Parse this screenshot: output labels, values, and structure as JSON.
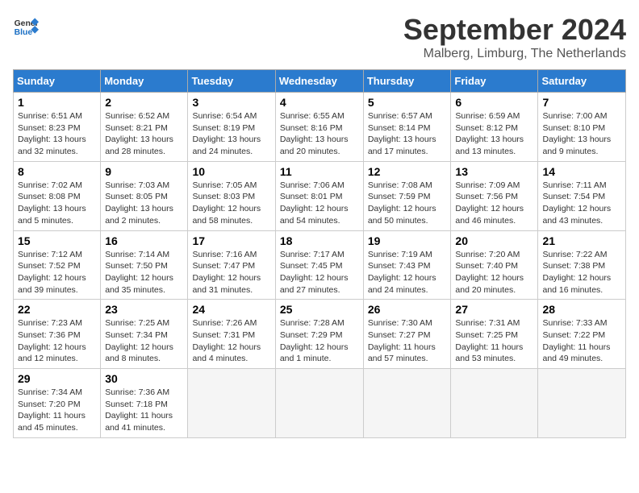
{
  "header": {
    "logo_line1": "General",
    "logo_line2": "Blue",
    "month_title": "September 2024",
    "subtitle": "Malberg, Limburg, The Netherlands"
  },
  "weekdays": [
    "Sunday",
    "Monday",
    "Tuesday",
    "Wednesday",
    "Thursday",
    "Friday",
    "Saturday"
  ],
  "weeks": [
    [
      {
        "day": "1",
        "info": "Sunrise: 6:51 AM\nSunset: 8:23 PM\nDaylight: 13 hours\nand 32 minutes."
      },
      {
        "day": "2",
        "info": "Sunrise: 6:52 AM\nSunset: 8:21 PM\nDaylight: 13 hours\nand 28 minutes."
      },
      {
        "day": "3",
        "info": "Sunrise: 6:54 AM\nSunset: 8:19 PM\nDaylight: 13 hours\nand 24 minutes."
      },
      {
        "day": "4",
        "info": "Sunrise: 6:55 AM\nSunset: 8:16 PM\nDaylight: 13 hours\nand 20 minutes."
      },
      {
        "day": "5",
        "info": "Sunrise: 6:57 AM\nSunset: 8:14 PM\nDaylight: 13 hours\nand 17 minutes."
      },
      {
        "day": "6",
        "info": "Sunrise: 6:59 AM\nSunset: 8:12 PM\nDaylight: 13 hours\nand 13 minutes."
      },
      {
        "day": "7",
        "info": "Sunrise: 7:00 AM\nSunset: 8:10 PM\nDaylight: 13 hours\nand 9 minutes."
      }
    ],
    [
      {
        "day": "8",
        "info": "Sunrise: 7:02 AM\nSunset: 8:08 PM\nDaylight: 13 hours\nand 5 minutes."
      },
      {
        "day": "9",
        "info": "Sunrise: 7:03 AM\nSunset: 8:05 PM\nDaylight: 13 hours\nand 2 minutes."
      },
      {
        "day": "10",
        "info": "Sunrise: 7:05 AM\nSunset: 8:03 PM\nDaylight: 12 hours\nand 58 minutes."
      },
      {
        "day": "11",
        "info": "Sunrise: 7:06 AM\nSunset: 8:01 PM\nDaylight: 12 hours\nand 54 minutes."
      },
      {
        "day": "12",
        "info": "Sunrise: 7:08 AM\nSunset: 7:59 PM\nDaylight: 12 hours\nand 50 minutes."
      },
      {
        "day": "13",
        "info": "Sunrise: 7:09 AM\nSunset: 7:56 PM\nDaylight: 12 hours\nand 46 minutes."
      },
      {
        "day": "14",
        "info": "Sunrise: 7:11 AM\nSunset: 7:54 PM\nDaylight: 12 hours\nand 43 minutes."
      }
    ],
    [
      {
        "day": "15",
        "info": "Sunrise: 7:12 AM\nSunset: 7:52 PM\nDaylight: 12 hours\nand 39 minutes."
      },
      {
        "day": "16",
        "info": "Sunrise: 7:14 AM\nSunset: 7:50 PM\nDaylight: 12 hours\nand 35 minutes."
      },
      {
        "day": "17",
        "info": "Sunrise: 7:16 AM\nSunset: 7:47 PM\nDaylight: 12 hours\nand 31 minutes."
      },
      {
        "day": "18",
        "info": "Sunrise: 7:17 AM\nSunset: 7:45 PM\nDaylight: 12 hours\nand 27 minutes."
      },
      {
        "day": "19",
        "info": "Sunrise: 7:19 AM\nSunset: 7:43 PM\nDaylight: 12 hours\nand 24 minutes."
      },
      {
        "day": "20",
        "info": "Sunrise: 7:20 AM\nSunset: 7:40 PM\nDaylight: 12 hours\nand 20 minutes."
      },
      {
        "day": "21",
        "info": "Sunrise: 7:22 AM\nSunset: 7:38 PM\nDaylight: 12 hours\nand 16 minutes."
      }
    ],
    [
      {
        "day": "22",
        "info": "Sunrise: 7:23 AM\nSunset: 7:36 PM\nDaylight: 12 hours\nand 12 minutes."
      },
      {
        "day": "23",
        "info": "Sunrise: 7:25 AM\nSunset: 7:34 PM\nDaylight: 12 hours\nand 8 minutes."
      },
      {
        "day": "24",
        "info": "Sunrise: 7:26 AM\nSunset: 7:31 PM\nDaylight: 12 hours\nand 4 minutes."
      },
      {
        "day": "25",
        "info": "Sunrise: 7:28 AM\nSunset: 7:29 PM\nDaylight: 12 hours\nand 1 minute."
      },
      {
        "day": "26",
        "info": "Sunrise: 7:30 AM\nSunset: 7:27 PM\nDaylight: 11 hours\nand 57 minutes."
      },
      {
        "day": "27",
        "info": "Sunrise: 7:31 AM\nSunset: 7:25 PM\nDaylight: 11 hours\nand 53 minutes."
      },
      {
        "day": "28",
        "info": "Sunrise: 7:33 AM\nSunset: 7:22 PM\nDaylight: 11 hours\nand 49 minutes."
      }
    ],
    [
      {
        "day": "29",
        "info": "Sunrise: 7:34 AM\nSunset: 7:20 PM\nDaylight: 11 hours\nand 45 minutes."
      },
      {
        "day": "30",
        "info": "Sunrise: 7:36 AM\nSunset: 7:18 PM\nDaylight: 11 hours\nand 41 minutes."
      },
      {
        "day": "",
        "info": ""
      },
      {
        "day": "",
        "info": ""
      },
      {
        "day": "",
        "info": ""
      },
      {
        "day": "",
        "info": ""
      },
      {
        "day": "",
        "info": ""
      }
    ]
  ]
}
